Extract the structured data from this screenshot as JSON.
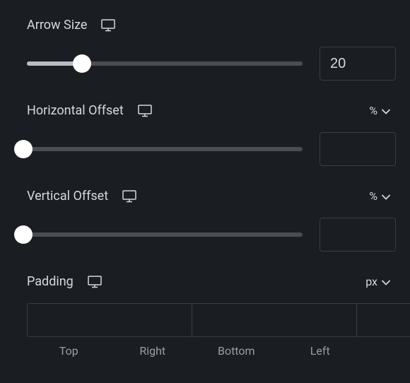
{
  "arrowSize": {
    "label": "Arrow Size",
    "value": "20",
    "sliderPercent": 20
  },
  "horizontalOffset": {
    "label": "Horizontal Offset",
    "unit": "%",
    "value": "",
    "sliderPercent": 0
  },
  "verticalOffset": {
    "label": "Vertical Offset",
    "unit": "%",
    "value": "",
    "sliderPercent": 0
  },
  "padding": {
    "label": "Padding",
    "unit": "px",
    "top": "",
    "right": "",
    "bottom": "",
    "left": "",
    "labels": {
      "top": "Top",
      "right": "Right",
      "bottom": "Bottom",
      "left": "Left"
    }
  }
}
